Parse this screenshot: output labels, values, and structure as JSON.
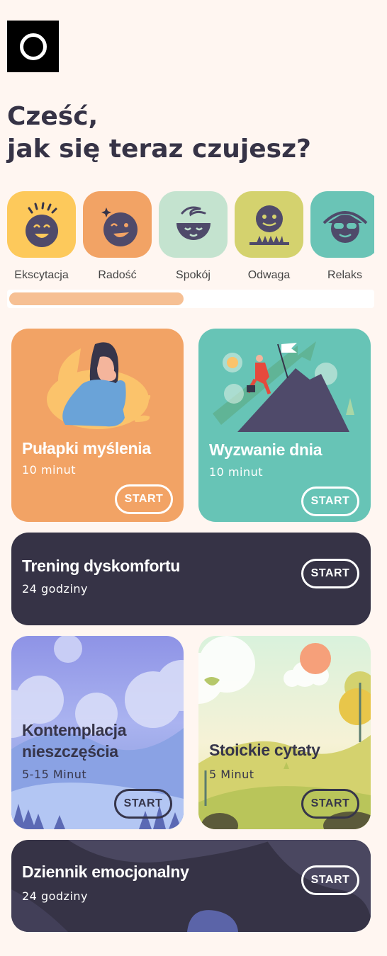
{
  "greeting": {
    "line1": "Cześć,",
    "line2": "jak się teraz czujesz?"
  },
  "moods": [
    {
      "label": "Ekscytacja",
      "icon": "excited-face-icon",
      "color": "#fdc95b"
    },
    {
      "label": "Radość",
      "icon": "happy-face-icon",
      "color": "#f2a365"
    },
    {
      "label": "Spokój",
      "icon": "calm-face-icon",
      "color": "#c4e3cf"
    },
    {
      "label": "Odwaga",
      "icon": "brave-face-icon",
      "color": "#d4d26e"
    },
    {
      "label": "Relaks",
      "icon": "relaxed-face-icon",
      "color": "#6ac4b6"
    }
  ],
  "moods_scroll_progress": 0.48,
  "cards": {
    "thinking_traps": {
      "title": "Pułapki myślenia",
      "duration": "10 minut",
      "start": "START",
      "color": "#f2a365"
    },
    "daily_challenge": {
      "title": "Wyzwanie dnia",
      "duration": "10 minut",
      "start": "START",
      "color": "#67c4b6"
    },
    "discomfort_training": {
      "title": "Trening dyskomfortu",
      "duration": "24 godziny",
      "start": "START",
      "color": "#363346"
    },
    "misfortune_contemplation": {
      "title1": "Kontemplacja",
      "title2": "nieszczęścia",
      "duration": "5-15 Minut",
      "start": "START"
    },
    "stoic_quotes": {
      "title": "Stoickie cytaty",
      "duration": "5 Minut",
      "start": "START"
    },
    "emotional_journal": {
      "title": "Dziennik emocjonalny",
      "duration": "24 godziny",
      "start": "START",
      "color": "#363346"
    }
  }
}
